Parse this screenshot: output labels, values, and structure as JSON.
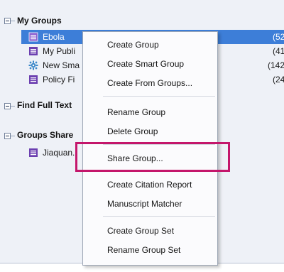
{
  "tree": {
    "my_groups": {
      "label": "My Groups",
      "items": [
        {
          "label": "Ebola",
          "count": "(52",
          "icon": "group-icon"
        },
        {
          "label": "My Publi",
          "count": "(41",
          "icon": "group-icon"
        },
        {
          "label": "New Sma",
          "count": "(142",
          "icon": "smart-group-icon"
        },
        {
          "label": "Policy Fi",
          "count": "(24",
          "icon": "group-icon"
        }
      ]
    },
    "find_full_text": {
      "label": "Find Full Text"
    },
    "groups_shared": {
      "label": "Groups Share",
      "items": [
        {
          "label": "Jiaquan.l",
          "icon": "group-icon"
        }
      ]
    }
  },
  "context_menu": {
    "items": [
      "Create Group",
      "Create Smart Group",
      "Create From Groups...",
      "Rename Group",
      "Delete Group",
      "Share Group...",
      "Create Citation Report",
      "Manuscript Matcher",
      "Create Group Set",
      "Rename Group Set"
    ],
    "highlighted_item": "Share Group..."
  },
  "colors": {
    "selection": "#3d7ed8",
    "highlight_border": "#c4166b",
    "group_icon": "#6b3fb0",
    "smart_icon": "#3a86c8",
    "panel_bg": "#eef1f7"
  }
}
